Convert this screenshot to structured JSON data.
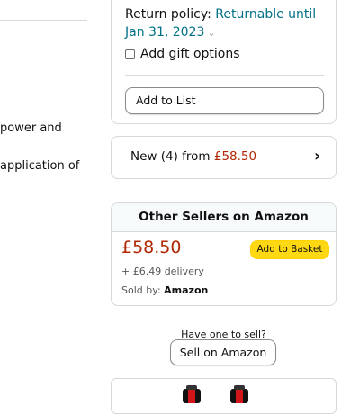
{
  "left_column": {
    "line1": "power and",
    "line2": "application of"
  },
  "buy_box": {
    "return_policy_label": "Return policy: ",
    "return_policy_link": "Returnable until",
    "return_policy_date": "Jan 31, 2023",
    "gift_options_label": "Add gift options",
    "gift_options_checked": false,
    "add_to_list_label": "Add to List"
  },
  "new_offers": {
    "prefix": "New (4) from ",
    "price": "£58.50",
    "arrow": "›"
  },
  "other_sellers": {
    "title": "Other Sellers on Amazon",
    "price": "£58.50",
    "basket_label": "Add to Basket",
    "delivery": "+ £6.49 delivery",
    "sold_by_label": "Sold by: ",
    "sold_by_name": "Amazon"
  },
  "sell": {
    "prompt": "Have one to sell?",
    "button_label": "Sell on Amazon"
  },
  "colors": {
    "link": "#007185",
    "price": "#b12704",
    "basket_button": "#ffd814"
  }
}
